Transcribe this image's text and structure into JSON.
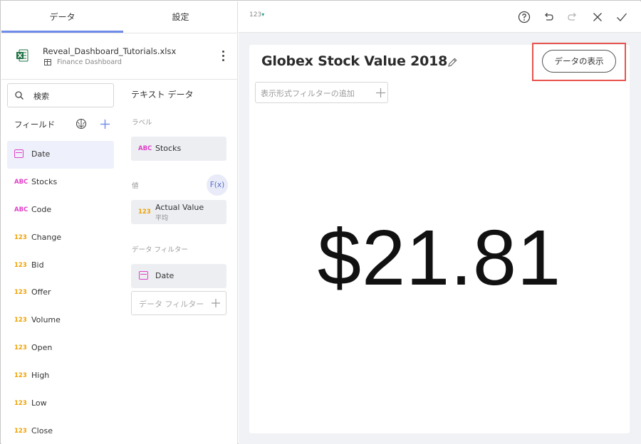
{
  "tabs": [
    {
      "label": "データ"
    },
    {
      "label": "設定"
    }
  ],
  "file": {
    "name": "Reveal_Dashboard_Tutorials.xlsx",
    "sheet": "Finance Dashboard",
    "icon": "excel-icon"
  },
  "search": {
    "placeholder": "検索"
  },
  "fields_header": "フィールド",
  "fields": [
    {
      "type": "date",
      "label": "Date"
    },
    {
      "type": "abc",
      "label": "Stocks",
      "icon_text": "ABC"
    },
    {
      "type": "abc",
      "label": "Code",
      "icon_text": "ABC"
    },
    {
      "type": "num",
      "label": "Change",
      "icon_text": "123"
    },
    {
      "type": "num",
      "label": "Bid",
      "icon_text": "123"
    },
    {
      "type": "num",
      "label": "Offer",
      "icon_text": "123"
    },
    {
      "type": "num",
      "label": "Volume",
      "icon_text": "123"
    },
    {
      "type": "num",
      "label": "Open",
      "icon_text": "123"
    },
    {
      "type": "num",
      "label": "High",
      "icon_text": "123"
    },
    {
      "type": "num",
      "label": "Low",
      "icon_text": "123"
    },
    {
      "type": "num",
      "label": "Close",
      "icon_text": "123"
    }
  ],
  "config": {
    "title": "テキスト データ",
    "label_section": "ラベル",
    "label_field": {
      "icon_text": "ABC",
      "label": "Stocks"
    },
    "value_section": "値",
    "fx_label": "F(x)",
    "value_field": {
      "icon_text": "123",
      "label": "Actual Value",
      "aggregation": "平均"
    },
    "filter_section": "データ フィルター",
    "filter_field": {
      "label": "Date"
    },
    "add_filter": "データ フィルター"
  },
  "toolbar": {
    "viz_type": "123"
  },
  "card": {
    "title": "Globex Stock Value 2018",
    "view_data_button": "データの表示",
    "add_visual_filter": "表示形式フィルターの追加",
    "kpi_value": "$21.81"
  },
  "colors": {
    "accent": "#6f8ce8",
    "abc_icon": "#e040c8",
    "num_icon": "#f2a200",
    "highlight": "#e8534d"
  }
}
